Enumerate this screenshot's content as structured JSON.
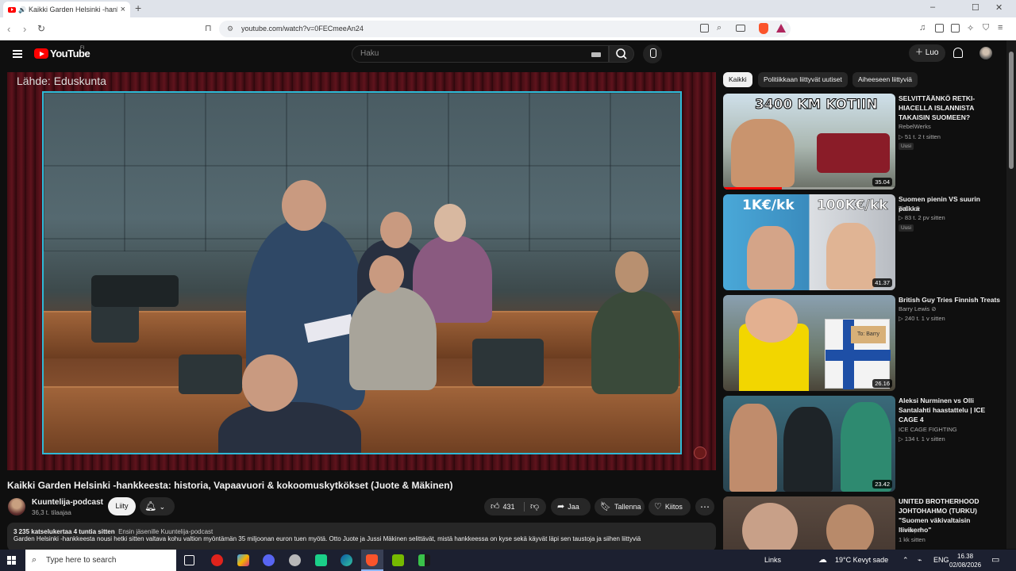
{
  "browser": {
    "tab_title": "Kaikki Garden Helsinki -hankk",
    "tab_close": "×",
    "new_tab": "+",
    "url": "youtube.com/watch?v=0FECmeeAn24",
    "window_buttons": [
      "–",
      "☐",
      "✕"
    ]
  },
  "header": {
    "logo_text": "YouTube",
    "logo_country": "FI",
    "search_placeholder": "Haku",
    "create_label": "Luo"
  },
  "player": {
    "source_label": "Lähde: Eduskunta"
  },
  "video": {
    "title": "Kaikki Garden Helsinki -hankkeesta: historia, Vapaavuori & kokoomuskytkökset (Juote & Mäkinen)",
    "channel_name": "Kuuntelija-podcast",
    "subscribers": "36,3 t. tilaajaa",
    "join_label": "Liity",
    "likes": "431",
    "share_label": "Jaa",
    "save_label": "Tallenna",
    "thanks_label": "Kiitos",
    "more_label": "⋯",
    "description_meta": "3 235 katselukertaa  4 tuntia sitten",
    "description_member": "Ensin jäsenille  Kuuntelija-podcast",
    "description_text": "Garden Helsinki -hankkeesta nousi hetki sitten valtava kohu valtion myöntämän 35 miljoonan euron tuen myötä. Otto Juote ja Jussi Mäkinen selittävät, mistä hankkeessa on kyse sekä käyvät läpi sen taustoja ja siihen liittyviä"
  },
  "sidebar": {
    "chips": [
      "Kaikki",
      "Politiikkaan liittyvät uutiset",
      "Aiheeseen liittyviä"
    ],
    "items": [
      {
        "title": "SELVITTÄÄNKÖ RETKI-HIACELLA ISLANNISTA TAKAISIN SUOMEEN?",
        "channel": "RebelWerks",
        "meta": "▷ 51 t.  2 t sitten",
        "badge": "Uusi",
        "duration": "35.04",
        "thumb_text": "3400 KM KOTIIN",
        "progress": 0.34
      },
      {
        "title": "Suomen pienin VS suurin palkka",
        "channel": "Tirfuu ⊘",
        "meta": "▷ 83 t.  2 pv sitten",
        "badge": "Uusi",
        "duration": "41.37",
        "thumb_text_left": "1K€/kk",
        "thumb_text_right": "100K€/kk"
      },
      {
        "title": "British Guy Tries Finnish Treats",
        "channel": "Barry Lewis ⊘",
        "meta": "▷ 240 t.  1 v sitten",
        "badge": "",
        "duration": "26.16",
        "thumb_text": "To: Barry"
      },
      {
        "title": "Aleksi Nurminen vs Olli Santalahti haastattelu | ICE CAGE 4",
        "channel": "ICE CAGE FIGHTING",
        "meta": "▷ 134 t.  1 v sitten",
        "badge": "",
        "duration": "23.42"
      },
      {
        "title": "UNITED BROTHERHOOD JOHTOHAHMO (TURKU) \"Suomen väkivaltaisin liivikerho\"",
        "channel": "Freeope",
        "meta": "1 kk sitten",
        "badge": "",
        "duration": ""
      }
    ]
  },
  "taskbar": {
    "search_placeholder": "Type here to search",
    "links_label": "Links",
    "weather": "19°C  Kevyt sade",
    "lang": "ENG",
    "time": "16.38",
    "date": "02/08/2026"
  },
  "colors": {
    "accent_red": "#ff0000",
    "frame_border": "#2fb9d6",
    "background": "#0f0f0f"
  }
}
